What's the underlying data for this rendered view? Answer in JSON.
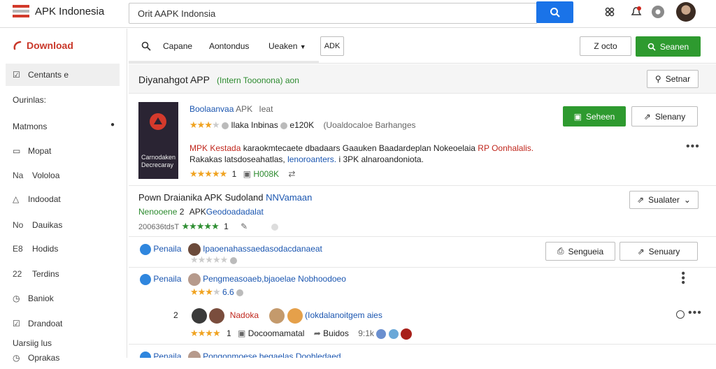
{
  "header": {
    "app_title": "APK Indonesia",
    "search_value": "Orit AAPK Indonsia",
    "search_icon": "search-icon",
    "icons": [
      "grid-icon",
      "notification-icon",
      "settings-icon"
    ]
  },
  "sidebar": {
    "download_label": "Download",
    "items": [
      {
        "label": "Centants e",
        "icon": "checkbox-icon"
      },
      {
        "label": "Ourinlas:",
        "icon": ""
      },
      {
        "label": "Matmons",
        "icon": ""
      },
      {
        "label": "Mopat",
        "icon": "image-icon"
      },
      {
        "label": "Vololoa",
        "icon": "Na"
      },
      {
        "label": "Indoodat",
        "icon": "triangle-icon"
      },
      {
        "label": "Dauikas",
        "icon": "No"
      },
      {
        "label": "Hodids",
        "icon": "E8"
      },
      {
        "label": "Terdins",
        "icon": "22"
      },
      {
        "label": "Baniok",
        "icon": "clock-icon"
      },
      {
        "label": "Drandoat",
        "icon": "checkbox-icon"
      },
      {
        "label": "Uarsiig lus",
        "icon": ""
      },
      {
        "label": "Oprakas",
        "icon": "clock-icon"
      }
    ]
  },
  "toolbar": {
    "tabs": [
      "Capane",
      "Aontondus",
      "Ueaken"
    ],
    "apk_badge": "ADK",
    "zoom_button": "Z octo",
    "search_button": "Seanen"
  },
  "strip": {
    "title": "Diyanahgot APP",
    "tag": "(Intern Tooonona) aon",
    "right_button": "Setnar"
  },
  "listing": {
    "thumb_text": [
      "Carnodaken",
      "Decrecaray"
    ],
    "title": "Boolaanvaa",
    "title_suffix": "APK",
    "title_extra": "Ieat",
    "meta_name": "Ilaka Inbinas",
    "meta_size": "e120K",
    "meta_extra": "(Uoaldocaloe Barhanges",
    "desc_prefix": "MPK Kestada",
    "desc_main": "karaokmtecaete dbadaars Gaauken Baadardeplan Nokeoelaia",
    "desc_red": "RP Oonhalalis.",
    "desc_line2a": "Rakakas latsdoseahatlas,",
    "desc_line2b": "lenoroanters.",
    "desc_line2c": "i 3PK alnaroandoniota.",
    "rating_count": "1",
    "rating_tag": "H008K",
    "primary_button": "Seheen",
    "secondary_button": "Slenany"
  },
  "section": {
    "heading": "Pown Draianika APK Sudoland",
    "heading_link": "NNVamaan",
    "sub_green": "Nenooene",
    "sub_num": "2",
    "sub_apk": "APK",
    "sub_link": "Geodoadadalat",
    "code": "200636tdsT",
    "rating_count": "1",
    "button": "Sualater"
  },
  "reviews": [
    {
      "user": "Penaila",
      "text": "Ipaoenahassaedasodacdanaeat",
      "btn1": "Sengueia",
      "btn2": "Senuary"
    },
    {
      "user": "Penaila",
      "text": "Pengmeasoaeb,bjaoelae Nobhoodoeo",
      "score": "6.6"
    },
    {
      "user": "Nadoka",
      "num": "2",
      "text": "(Iokdalanoitgem aies",
      "count": "1",
      "meta1": "Docoomamatal",
      "meta2": "Buidos",
      "meta3": "9:1k"
    },
    {
      "user": "Penaila",
      "text": "Pongonmoese begaelas Doohledaed"
    }
  ]
}
